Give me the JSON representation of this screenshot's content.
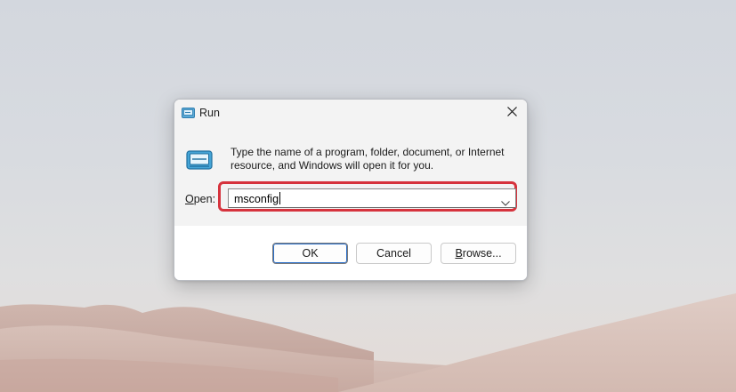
{
  "window": {
    "title": "Run",
    "close_icon": "close-icon",
    "app_icon": "run-icon"
  },
  "dialog": {
    "description_line1": "Type the name of a program, folder, document, or Internet",
    "description_line2": "resource, and Windows will open it for you.",
    "open_label_mnemonic": "O",
    "open_label_rest": "pen:",
    "input_value": "msconfig",
    "highlight_color": "#d6333d"
  },
  "buttons": {
    "ok": "OK",
    "cancel": "Cancel",
    "browse_mnemonic": "B",
    "browse_rest": "rowse..."
  }
}
